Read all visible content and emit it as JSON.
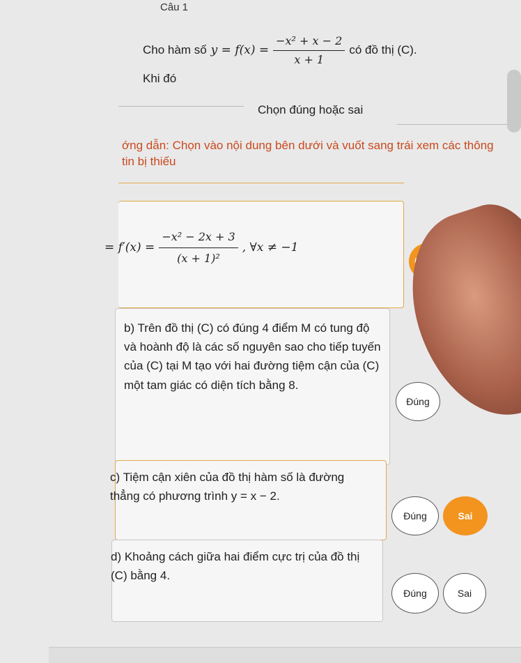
{
  "question": {
    "number_label": "Câu 1"
  },
  "statement": {
    "prefix": "Cho hàm số",
    "function_lhs": "y = f(x) =",
    "numerator": "−x² + x − 2",
    "denominator": "x + 1",
    "suffix": "có đồ thị (C).",
    "line2": "Khi đó"
  },
  "mode_title": "Chọn đúng hoặc sai",
  "instruction": "ớng dẫn: Chọn vào nội dung bên dưới và vuốt sang trái xem các thông tin bị thiếu",
  "statements": [
    {
      "id": "a",
      "lhs": "= f′(x) =",
      "numerator": "−x² − 2x + 3",
      "denominator": "(x + 1)²",
      "condition": ", ∀x ≠ −1",
      "selected": "Đúng"
    },
    {
      "id": "b",
      "text": "b) Trên đồ thị (C) có đúng 4 điểm M có tung độ và hoành độ là các số nguyên sao cho tiếp tuyến của (C) tại M tạo với hai đường tiệm cận của (C) một tam giác có diện tích bằng 8.",
      "selected": ""
    },
    {
      "id": "c",
      "text": "c) Tiệm cận xiên của đồ thị hàm số là đường thẳng có phương trình y = x − 2.",
      "selected": "Sai"
    },
    {
      "id": "d",
      "text": "d) Khoảng cách giữa hai điểm cực trị của đồ thị (C) bằng 4.",
      "selected": ""
    }
  ],
  "buttons": {
    "true_label": "Đúng",
    "false_label": "Sai"
  },
  "colors": {
    "accent": "#f2941e",
    "instruction_text": "#c94a1c",
    "card_bg": "#f6f6f6"
  }
}
